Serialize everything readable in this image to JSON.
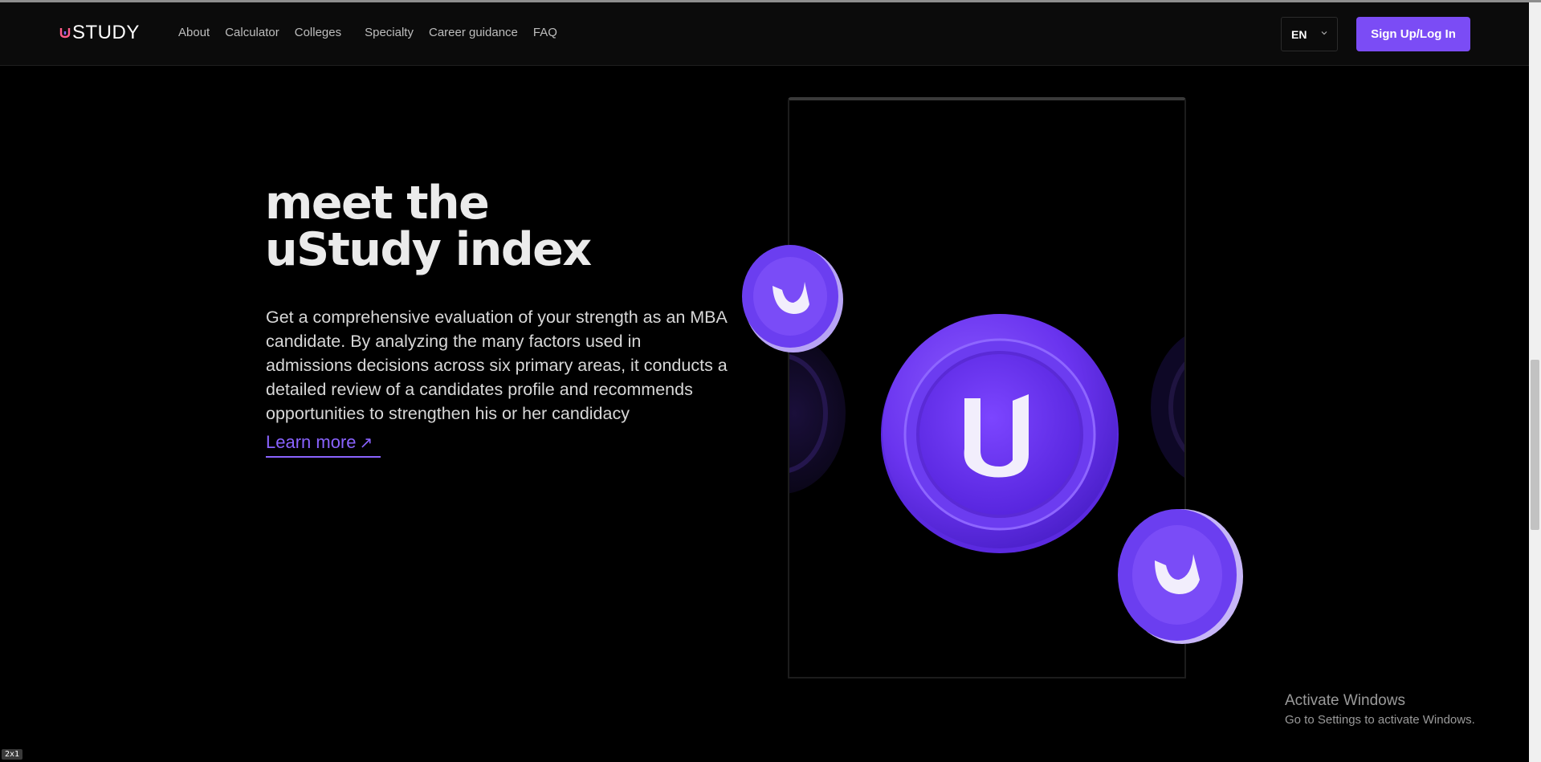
{
  "header": {
    "logo_text": "STUDY",
    "nav": [
      "About",
      "Calculator",
      "Colleges",
      "Specialty",
      "Career guidance",
      "FAQ"
    ],
    "lang": "EN",
    "signup_label": "Sign Up/Log In"
  },
  "hero": {
    "title_line1": "meet the",
    "title_line2": "uStudy index",
    "description": "Get a comprehensive evaluation of your strength as an MBA candidate. By analyzing the many factors used in admissions decisions across six primary areas, it conducts a detailed review of a candidates profile and recommends opportunities to strengthen his or her candidacy",
    "learn_more": "Learn more",
    "learn_more_icon": "arrow-up-right-icon"
  },
  "watermark": {
    "line1": "Activate Windows",
    "line2": "Go to Settings to activate Windows."
  },
  "badge": "2x1",
  "colors": {
    "accent": "#7b4cf5",
    "background": "#000000",
    "link": "#8a63ff"
  }
}
